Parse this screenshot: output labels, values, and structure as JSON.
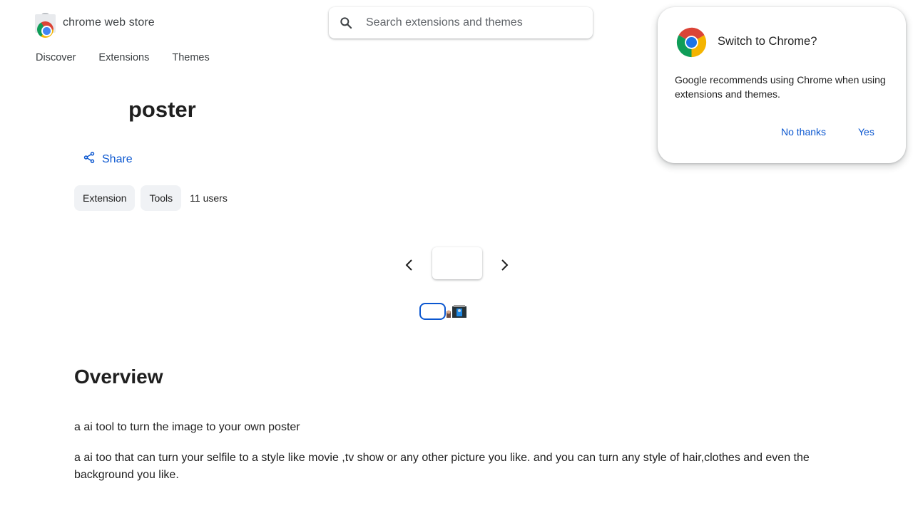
{
  "header": {
    "store_name": "chrome web store",
    "search_placeholder": "Search extensions and themes"
  },
  "nav": {
    "items": [
      "Discover",
      "Extensions",
      "Themes"
    ]
  },
  "item": {
    "title": "poster",
    "share_label": "Share",
    "chips": [
      "Extension",
      "Tools"
    ],
    "users": "11 users"
  },
  "overview": {
    "heading": "Overview",
    "summary": "a ai tool to turn the image to your own poster",
    "description": "a ai too that can turn your selfile to a style like movie ,tv show or any other picture you like. and you can turn any style of hair,clothes and even the background you like."
  },
  "popup": {
    "title": "Switch to Chrome?",
    "body": "Google recommends using Chrome when using extensions and themes.",
    "no_label": "No thanks",
    "yes_label": "Yes"
  },
  "colors": {
    "link_blue": "#0b57d0",
    "chip_bg": "#f0f2f5"
  },
  "icons": [
    "chrome-web-store-icon",
    "search-icon",
    "share-icon",
    "chevron-left-icon",
    "chevron-right-icon",
    "chrome-logo-icon"
  ]
}
